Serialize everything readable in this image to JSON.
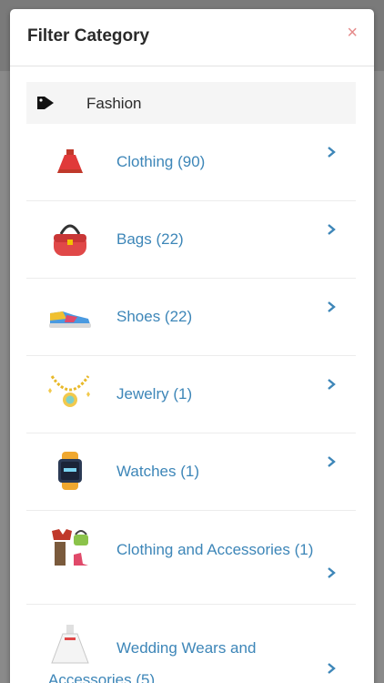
{
  "modal": {
    "title": "Filter Category",
    "close_symbol": "×"
  },
  "parent": {
    "icon": "tag-icon",
    "label": "Fashion"
  },
  "categories": [
    {
      "label": "Clothing (90)",
      "icon": "dress-icon"
    },
    {
      "label": "Bags (22)",
      "icon": "handbag-icon"
    },
    {
      "label": "Shoes (22)",
      "icon": "sneaker-icon"
    },
    {
      "label": "Jewelry (1)",
      "icon": "necklace-icon"
    },
    {
      "label": "Watches (1)",
      "icon": "watch-icon"
    },
    {
      "label": "Clothing and Accessories (1)",
      "icon": "outfit-icon"
    },
    {
      "label": "Wedding Wears and Accessories (5)",
      "icon": "wedding-dress-icon"
    }
  ],
  "colors": {
    "link": "#3d86b8",
    "close": "#e58a8a",
    "title": "#2a2a2a"
  }
}
